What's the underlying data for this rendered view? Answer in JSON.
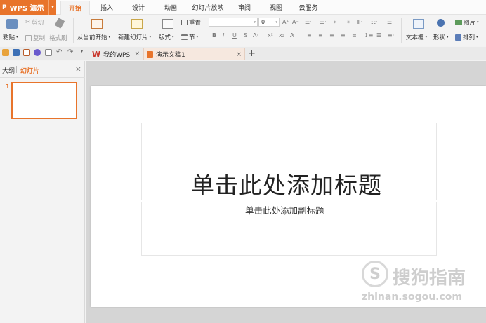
{
  "app": {
    "name": "WPS 演示",
    "menu_caret": "▾"
  },
  "menu_tabs": [
    "开始",
    "插入",
    "设计",
    "动画",
    "幻灯片放映",
    "审阅",
    "视图",
    "云服务"
  ],
  "ribbon": {
    "paste": "粘贴",
    "cut": "剪切",
    "copy": "复制",
    "format_painter": "格式刷",
    "from_current": "从当前开始",
    "new_slide": "新建幻灯片",
    "layout": "版式",
    "reset": "重置",
    "section": "节",
    "font_size": "0",
    "text_box": "文本框",
    "shape": "形状",
    "picture": "图片",
    "arrange": "排列"
  },
  "tabs": {
    "my_wps": "我的WPS",
    "document": "演示文稿1",
    "close": "×",
    "new_tab": "+"
  },
  "sidepanel": {
    "outline": "大纲",
    "slides": "幻灯片",
    "close": "×",
    "slide_number": "1"
  },
  "slide": {
    "title": "单击此处添加标题",
    "subtitle": "单击此处添加副标题"
  },
  "watermark": {
    "title": "搜狗指南",
    "url": "zhinan.sogou.com"
  },
  "colors": {
    "accent": "#e8742b",
    "ribbon_bg": "#f3f3f3",
    "canvas_bg": "#d5d5d5"
  }
}
